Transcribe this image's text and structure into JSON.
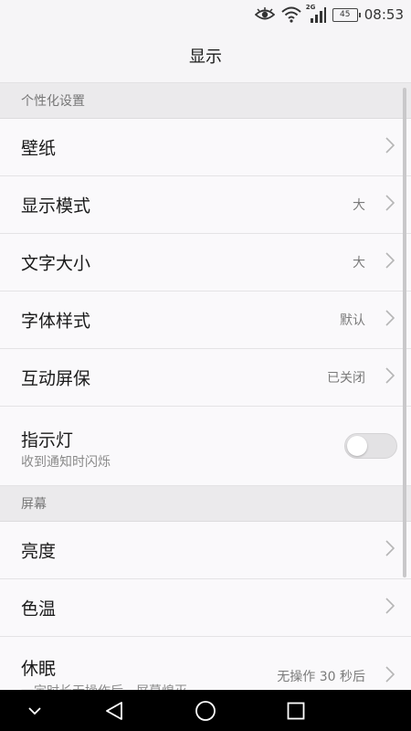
{
  "status_bar": {
    "network_label": "2G",
    "battery_level": "45",
    "time": "08:53",
    "icons": [
      "eye-icon",
      "wifi-icon",
      "signal-icon",
      "battery-icon"
    ]
  },
  "header": {
    "title": "显示"
  },
  "sections": [
    {
      "header": "个性化设置",
      "items": [
        {
          "label": "壁纸"
        },
        {
          "label": "显示模式",
          "value": "大"
        },
        {
          "label": "文字大小",
          "value": "大"
        },
        {
          "label": "字体样式",
          "value": "默认"
        },
        {
          "label": "互动屏保",
          "value": "已关闭"
        },
        {
          "label": "指示灯",
          "sublabel": "收到通知时闪烁",
          "toggle": "off"
        }
      ]
    },
    {
      "header": "屏幕",
      "items": [
        {
          "label": "亮度"
        },
        {
          "label": "色温"
        },
        {
          "label": "休眠",
          "sublabel": "一定时长无操作后，屏幕熄灭",
          "value": "无操作 30 秒后"
        }
      ]
    }
  ],
  "colors": {
    "background": "#f6f5f7",
    "row": "#faf9fb",
    "section": "#ebeaec",
    "nav_bar": "#000000"
  },
  "nav_bar": {
    "icons": [
      "chevron-down-icon",
      "back-icon",
      "home-icon",
      "recents-icon"
    ]
  }
}
